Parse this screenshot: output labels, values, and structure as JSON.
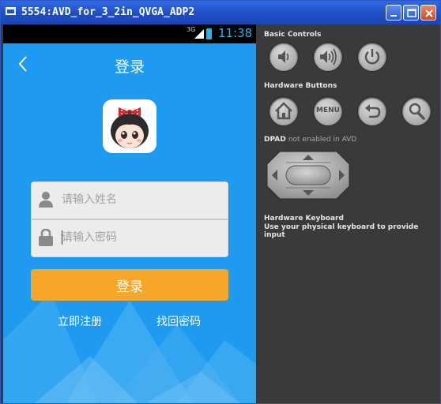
{
  "window": {
    "title": "5554:AVD_for_3_2in_QVGA_ADP2",
    "buttons": [
      "minimize",
      "maximize",
      "close"
    ]
  },
  "phone": {
    "status_bar": {
      "network": "3G",
      "time": "11:38",
      "icons": [
        "signal-icon",
        "battery-icon"
      ]
    },
    "header": {
      "back_icon": "back-arrow-icon",
      "title": "登录"
    },
    "avatar": "cartoon-girl-avatar",
    "form": {
      "username_placeholder": "请输入姓名",
      "username_icon": "user-icon",
      "password_placeholder": "请输入密码",
      "password_icon": "lock-icon"
    },
    "login_button": "登录",
    "register_link": "立即注册",
    "find_password_link": "找回密码",
    "colors": {
      "background": "#1e9bf0",
      "button": "#f6a72a",
      "text": "#ffffff"
    }
  },
  "controls": {
    "basic_controls_label": "Basic Controls",
    "basic_controls": [
      "volume-down-icon",
      "volume-up-icon",
      "power-icon"
    ],
    "hardware_buttons_label": "Hardware Buttons",
    "hardware_buttons": [
      "home-icon",
      "menu-button",
      "back-icon",
      "search-icon"
    ],
    "menu_label": "MENU",
    "dpad_label": "DPAD",
    "dpad_note": "not enabled in AVD",
    "keyboard_title": "Hardware Keyboard",
    "keyboard_hint": "Use your physical keyboard to provide input"
  }
}
